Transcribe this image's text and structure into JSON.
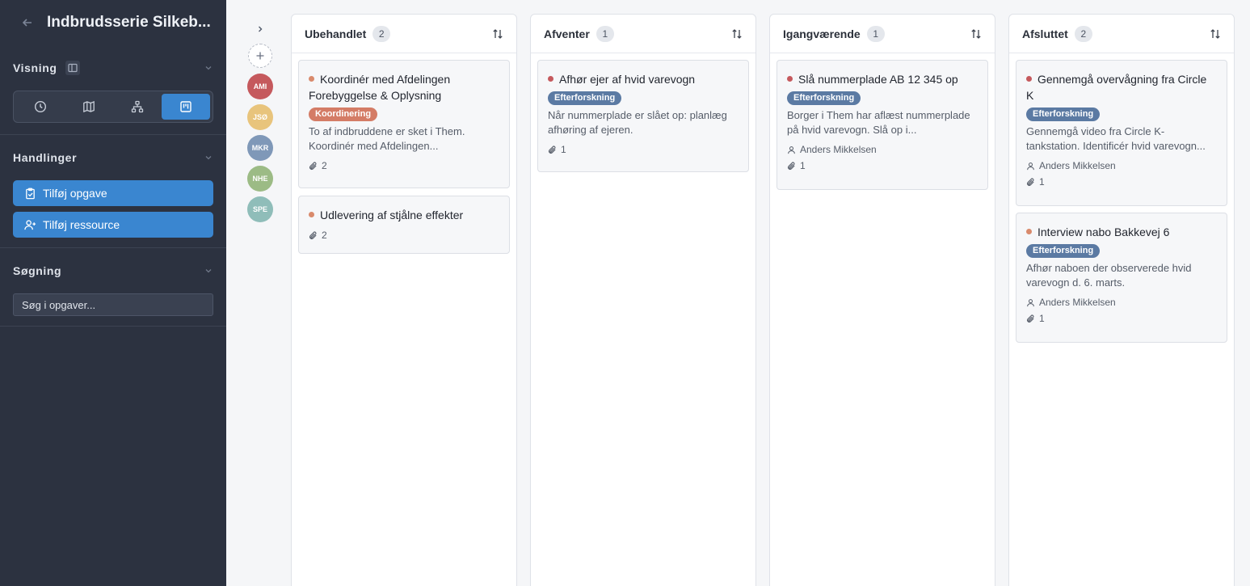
{
  "sidebar": {
    "title": "Indbrudsserie Silkeb...",
    "sections": {
      "view": {
        "title": "Visning"
      },
      "actions": {
        "title": "Handlinger",
        "add_task": "Tilføj opgave",
        "add_resource": "Tilføj ressource"
      },
      "search": {
        "title": "Søgning",
        "placeholder": "Søg i opgaver..."
      }
    },
    "view_modes": [
      "timeline",
      "map",
      "hierarchy",
      "board"
    ],
    "active_view": "board"
  },
  "resources": [
    {
      "initials": "AMI",
      "color": "#c5595d"
    },
    {
      "initials": "JSØ",
      "color": "#e8c47c"
    },
    {
      "initials": "MKR",
      "color": "#7f98b8"
    },
    {
      "initials": "NHE",
      "color": "#9cbb85"
    },
    {
      "initials": "SPE",
      "color": "#8fbdb9"
    }
  ],
  "columns": [
    {
      "title": "Ubehandlet",
      "count": "2",
      "cards": [
        {
          "title": "Koordinér med Afdelingen Forebyggelse & Oplysning",
          "dot_color": "#d98a6c",
          "tag": "Koordinering",
          "tag_color": "#d47c66",
          "desc": "To af indbruddene er sket i Them. Koordinér med Afdelingen...",
          "assignee": "",
          "attachments": "2"
        },
        {
          "title": "Udlevering af stjålne effekter",
          "dot_color": "#d98a6c",
          "tag": "",
          "tag_color": "",
          "desc": "",
          "assignee": "",
          "attachments": "2"
        }
      ]
    },
    {
      "title": "Afventer",
      "count": "1",
      "cards": [
        {
          "title": "Afhør ejer af hvid varevogn",
          "dot_color": "#c5595d",
          "tag": "Efterforskning",
          "tag_color": "#5b7aa3",
          "desc": "Når nummerplade er slået op: planlæg afhøring af ejeren.",
          "assignee": "",
          "attachments": "1"
        }
      ]
    },
    {
      "title": "Igangværende",
      "count": "1",
      "cards": [
        {
          "title": "Slå nummerplade AB 12 345 op",
          "dot_color": "#c5595d",
          "tag": "Efterforskning",
          "tag_color": "#5b7aa3",
          "desc": "Borger i Them har aflæst nummerplade på hvid varevogn. Slå op i...",
          "assignee": "Anders Mikkelsen",
          "attachments": "1"
        }
      ]
    },
    {
      "title": "Afsluttet",
      "count": "2",
      "cards": [
        {
          "title": "Gennemgå overvågning fra Circle K",
          "dot_color": "#c5595d",
          "tag": "Efterforskning",
          "tag_color": "#5b7aa3",
          "desc": "Gennemgå video fra Circle K-tankstation. Identificér hvid varevogn...",
          "assignee": "Anders Mikkelsen",
          "attachments": "1"
        },
        {
          "title": "Interview nabo Bakkevej 6",
          "dot_color": "#d98a6c",
          "tag": "Efterforskning",
          "tag_color": "#5b7aa3",
          "desc": "Afhør naboen der observerede hvid varevogn d. 6. marts.",
          "assignee": "Anders Mikkelsen",
          "attachments": "1"
        }
      ]
    }
  ]
}
